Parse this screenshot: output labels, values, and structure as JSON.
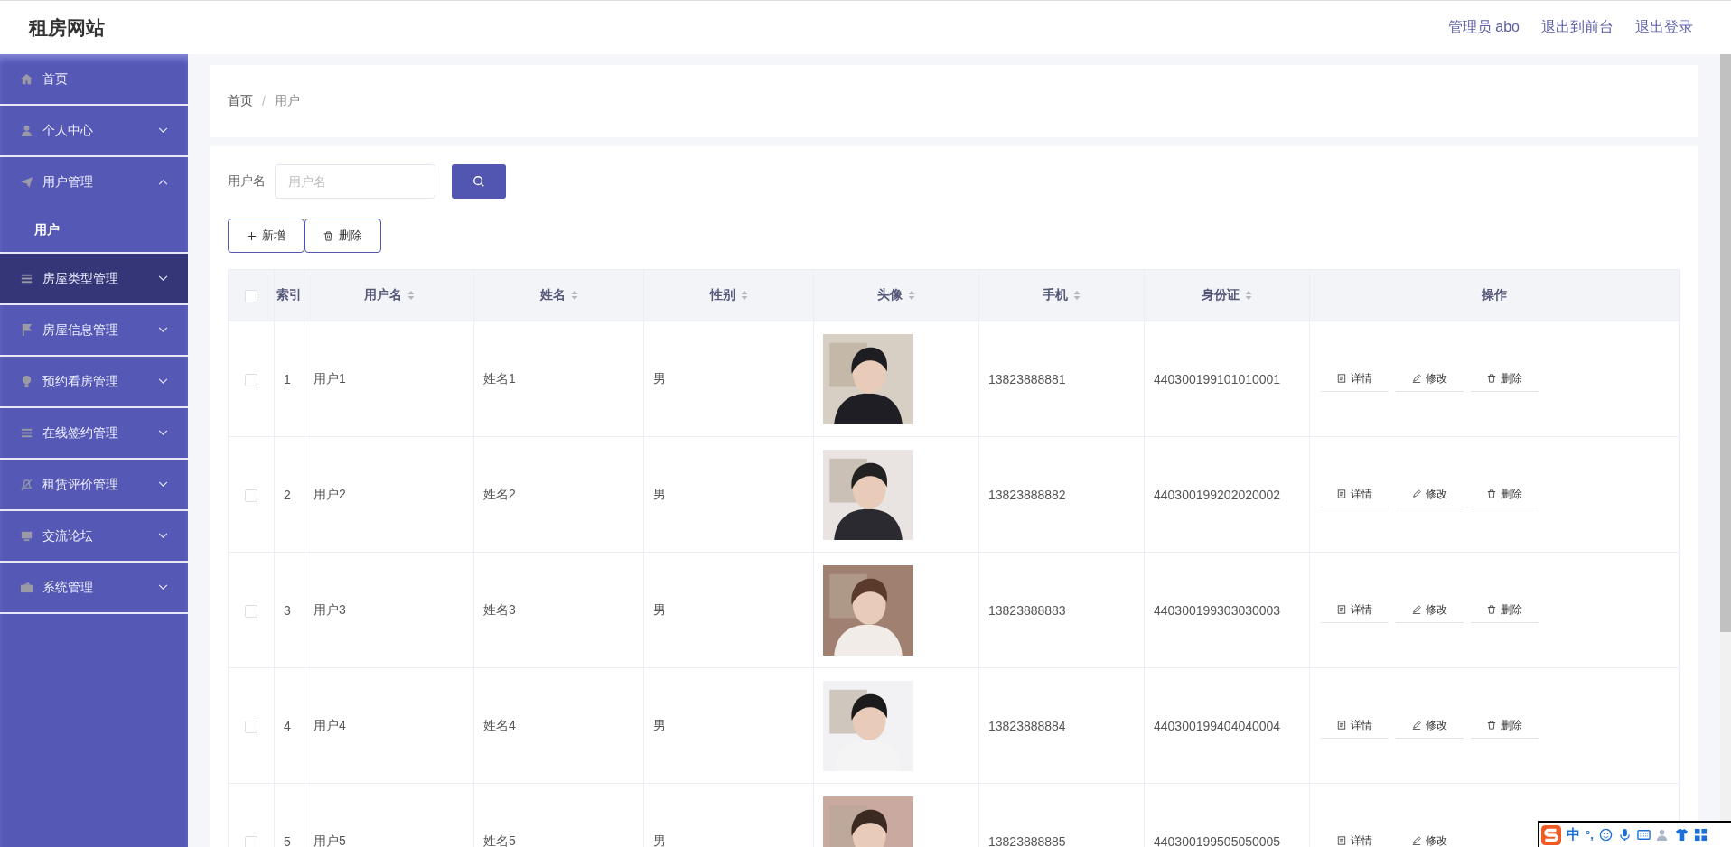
{
  "header": {
    "title": "租房网站",
    "links": [
      "管理员 abo",
      "退出到前台",
      "退出登录"
    ]
  },
  "sidebar": {
    "items": [
      {
        "label": "首页",
        "kind": "link",
        "hovered": false
      },
      {
        "label": "个人中心",
        "kind": "menu",
        "expanded": false,
        "hovered": false
      },
      {
        "label": "用户管理",
        "kind": "menu",
        "expanded": true,
        "hovered": false,
        "children": [
          {
            "label": "用户"
          }
        ]
      },
      {
        "label": "房屋类型管理",
        "kind": "menu",
        "expanded": false,
        "hovered": true
      },
      {
        "label": "房屋信息管理",
        "kind": "menu",
        "expanded": false,
        "hovered": false
      },
      {
        "label": "预约看房管理",
        "kind": "menu",
        "expanded": false,
        "hovered": false
      },
      {
        "label": "在线签约管理",
        "kind": "menu",
        "expanded": false,
        "hovered": false
      },
      {
        "label": "租赁评价管理",
        "kind": "menu",
        "expanded": false,
        "hovered": false
      },
      {
        "label": "交流论坛",
        "kind": "menu",
        "expanded": false,
        "hovered": false
      },
      {
        "label": "系统管理",
        "kind": "menu",
        "expanded": false,
        "hovered": false
      }
    ]
  },
  "breadcrumb": {
    "items": [
      "首页",
      "用户"
    ],
    "separator": "/"
  },
  "search": {
    "label": "用户名",
    "placeholder": "用户名"
  },
  "toolbar": {
    "buttons": [
      {
        "label": "新增",
        "kind": "add"
      },
      {
        "label": "删除",
        "kind": "delete"
      }
    ]
  },
  "table": {
    "select_all": false,
    "columns": [
      {
        "label": "索引",
        "sortable": false
      },
      {
        "label": "用户名",
        "sortable": true
      },
      {
        "label": "姓名",
        "sortable": true
      },
      {
        "label": "性别",
        "sortable": true
      },
      {
        "label": "头像",
        "sortable": true
      },
      {
        "label": "手机",
        "sortable": true
      },
      {
        "label": "身份证",
        "sortable": true
      },
      {
        "label": "操作",
        "sortable": false
      }
    ],
    "rows": [
      {
        "selected": false,
        "index": "1",
        "username": "用户1",
        "name": "姓名1",
        "gender": "男",
        "avatar": {
          "kind": "picture"
        },
        "phone": "13823888881",
        "id_card": "440300199101010001",
        "actions": [
          {
            "label": "详情",
            "kind": "detail"
          },
          {
            "label": "修改",
            "kind": "edit"
          },
          {
            "label": "删除",
            "kind": "delete"
          }
        ]
      },
      {
        "selected": false,
        "index": "2",
        "username": "用户2",
        "name": "姓名2",
        "gender": "男",
        "avatar": {
          "kind": "picture"
        },
        "phone": "13823888882",
        "id_card": "440300199202020002",
        "actions": [
          {
            "label": "详情",
            "kind": "detail"
          },
          {
            "label": "修改",
            "kind": "edit"
          },
          {
            "label": "删除",
            "kind": "delete"
          }
        ]
      },
      {
        "selected": false,
        "index": "3",
        "username": "用户3",
        "name": "姓名3",
        "gender": "男",
        "avatar": {
          "kind": "picture"
        },
        "phone": "13823888883",
        "id_card": "440300199303030003",
        "actions": [
          {
            "label": "详情",
            "kind": "detail"
          },
          {
            "label": "修改",
            "kind": "edit"
          },
          {
            "label": "删除",
            "kind": "delete"
          }
        ]
      },
      {
        "selected": false,
        "index": "4",
        "username": "用户4",
        "name": "姓名4",
        "gender": "男",
        "avatar": {
          "kind": "picture"
        },
        "phone": "13823888884",
        "id_card": "440300199404040004",
        "actions": [
          {
            "label": "详情",
            "kind": "detail"
          },
          {
            "label": "修改",
            "kind": "edit"
          },
          {
            "label": "删除",
            "kind": "delete"
          }
        ]
      },
      {
        "selected": false,
        "index": "5",
        "username": "用户5",
        "name": "姓名5",
        "gender": "男",
        "avatar": {
          "kind": "picture"
        },
        "phone": "13823888885",
        "id_card": "440300199505050005",
        "actions": [
          {
            "label": "详情",
            "kind": "detail"
          },
          {
            "label": "修改",
            "kind": "edit"
          }
        ]
      }
    ]
  },
  "ime_toolbar": {
    "mode": "中",
    "punctuation": "°,"
  }
}
